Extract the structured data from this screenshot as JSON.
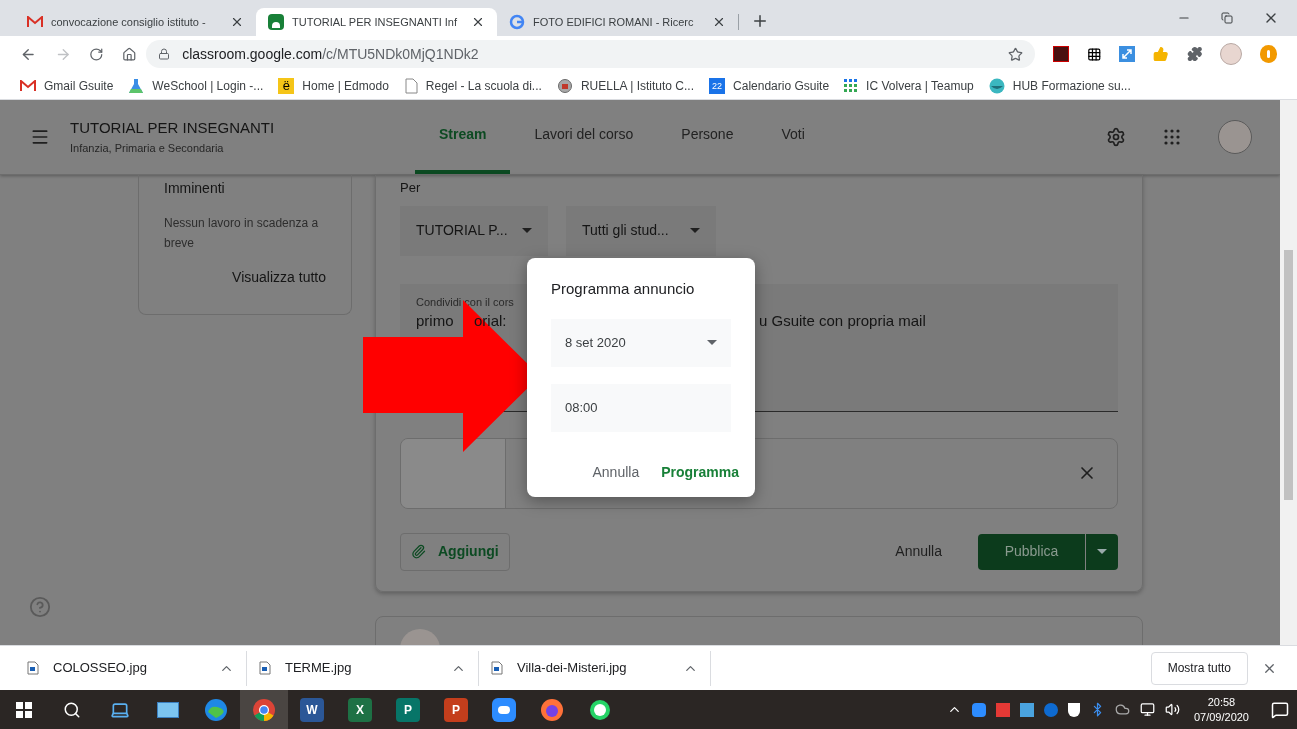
{
  "browser": {
    "tabs": [
      {
        "title": "convocazione consiglio istituto -",
        "selected": false
      },
      {
        "title": "TUTORIAL PER INSEGNANTI Inf",
        "selected": true
      },
      {
        "title": "FOTO EDIFICI ROMANI - Ricerc",
        "selected": false
      }
    ],
    "address_host": "classroom.google.com",
    "address_path": "/c/MTU5NDk0MjQ1NDk2",
    "bookmarks": [
      {
        "label": "Gmail Gsuite"
      },
      {
        "label": "WeSchool | Login -..."
      },
      {
        "label": "Home | Edmodo",
        "glyph": "ë"
      },
      {
        "label": "Regel - La scuola di..."
      },
      {
        "label": "RUELLA | Istituto C..."
      },
      {
        "label": "Calendario Gsuite",
        "glyph": "22"
      },
      {
        "label": "IC Volvera | Teamup"
      },
      {
        "label": "HUB Formazione su..."
      }
    ]
  },
  "app": {
    "course_title": "TUTORIAL PER INSEGNANTI",
    "course_subtitle": "Infanzia, Primaria e Secondaria",
    "nav_tabs": [
      {
        "label": "Stream",
        "selected": true
      },
      {
        "label": "Lavori del corso",
        "selected": false
      },
      {
        "label": "Persone",
        "selected": false
      },
      {
        "label": "Voti",
        "selected": false
      }
    ],
    "upcoming": {
      "title": "Imminenti",
      "text": "Nessun lavoro in scadenza a breve",
      "link": "Visualizza tutto"
    },
    "composer": {
      "for_label": "Per",
      "class_select": "TUTORIAL P...",
      "students_select": "Tutti gli stud...",
      "hint": "Condividi con il cors",
      "fragments": [
        "primo",
        "orial:",
        "u Gsuite con propria mail"
      ],
      "add": "Aggiungi",
      "cancel": "Annulla",
      "publish": "Pubblica"
    }
  },
  "dialog": {
    "title": "Programma annuncio",
    "date": "8 set 2020",
    "time": "08:00",
    "cancel": "Annulla",
    "confirm": "Programma"
  },
  "downloads": {
    "files": [
      "COLOSSEO.jpg",
      "TERME.jpg",
      "Villa-dei-Misteri.jpg"
    ],
    "show_all": "Mostra tutto"
  },
  "taskbar": {
    "apps": [
      {
        "kind": "edge",
        "selected": false
      },
      {
        "kind": "chrome",
        "selected": true
      },
      {
        "kind": "office",
        "glyph": "W",
        "color": "#2b5797",
        "selected": false
      },
      {
        "kind": "office",
        "glyph": "X",
        "color": "#1e7145",
        "selected": false
      },
      {
        "kind": "office",
        "glyph": "P",
        "color": "#077568",
        "selected": false
      },
      {
        "kind": "office",
        "glyph": "P",
        "color": "#c43e1c",
        "selected": false
      },
      {
        "kind": "zoom",
        "selected": false
      },
      {
        "kind": "firefox",
        "selected": false
      },
      {
        "kind": "whatsapp",
        "selected": false
      }
    ],
    "time": "20:58",
    "date": "07/09/2020"
  }
}
